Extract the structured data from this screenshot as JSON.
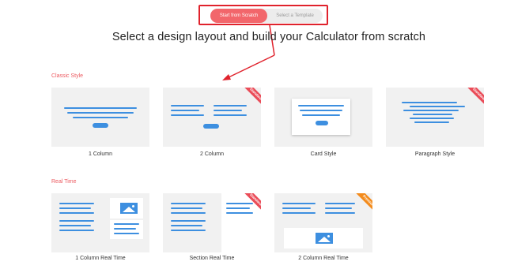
{
  "toggle": {
    "active_label": "Start from Scratch",
    "inactive_label": "Select a Template"
  },
  "headline": "Select a design layout and build your Calculator from scratch",
  "sections": {
    "classic": {
      "label": "Classic Style",
      "cards": [
        {
          "label": "1 Column"
        },
        {
          "label": "2 Column",
          "ribbon": "Standard ✦"
        },
        {
          "label": "Card Style"
        },
        {
          "label": "Paragraph Style",
          "ribbon": "Standard ✦"
        }
      ]
    },
    "realtime": {
      "label": "Real Time",
      "cards": [
        {
          "label": "1 Column Real Time"
        },
        {
          "label": "Section Real Time",
          "ribbon": "Standard ✦"
        },
        {
          "label": "2 Column Real Time",
          "ribbon": "Premium"
        }
      ]
    }
  },
  "colors": {
    "accent": "#f2666b",
    "annotation": "#e0222c",
    "line_blue": "#3d8fe0",
    "ribbon_red": "#ea4c58",
    "ribbon_orange": "#f38b1c"
  }
}
